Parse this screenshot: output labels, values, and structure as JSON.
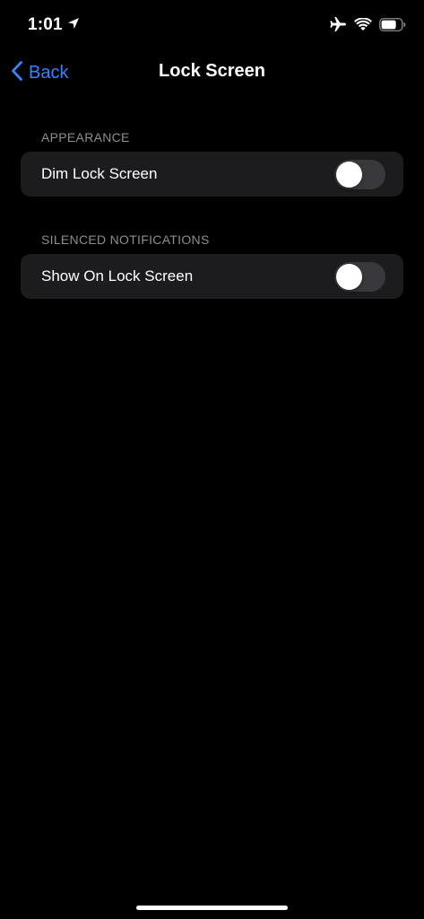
{
  "status_bar": {
    "time": "1:01",
    "icons": [
      "location-arrow-icon",
      "airplane-icon",
      "wifi-icon",
      "battery-icon"
    ],
    "battery_level": 0.75
  },
  "nav": {
    "back_label": "Back",
    "title": "Lock Screen"
  },
  "sections": [
    {
      "header": "APPEARANCE",
      "rows": [
        {
          "label": "Dim Lock Screen",
          "toggle_on": false
        }
      ]
    },
    {
      "header": "SILENCED NOTIFICATIONS",
      "rows": [
        {
          "label": "Show On Lock Screen",
          "toggle_on": false
        }
      ]
    }
  ],
  "colors": {
    "background": "#000000",
    "group_background": "#1c1c1e",
    "accent": "#3a82f7",
    "section_header": "#8d8d93",
    "toggle_off_track": "#39393d"
  }
}
